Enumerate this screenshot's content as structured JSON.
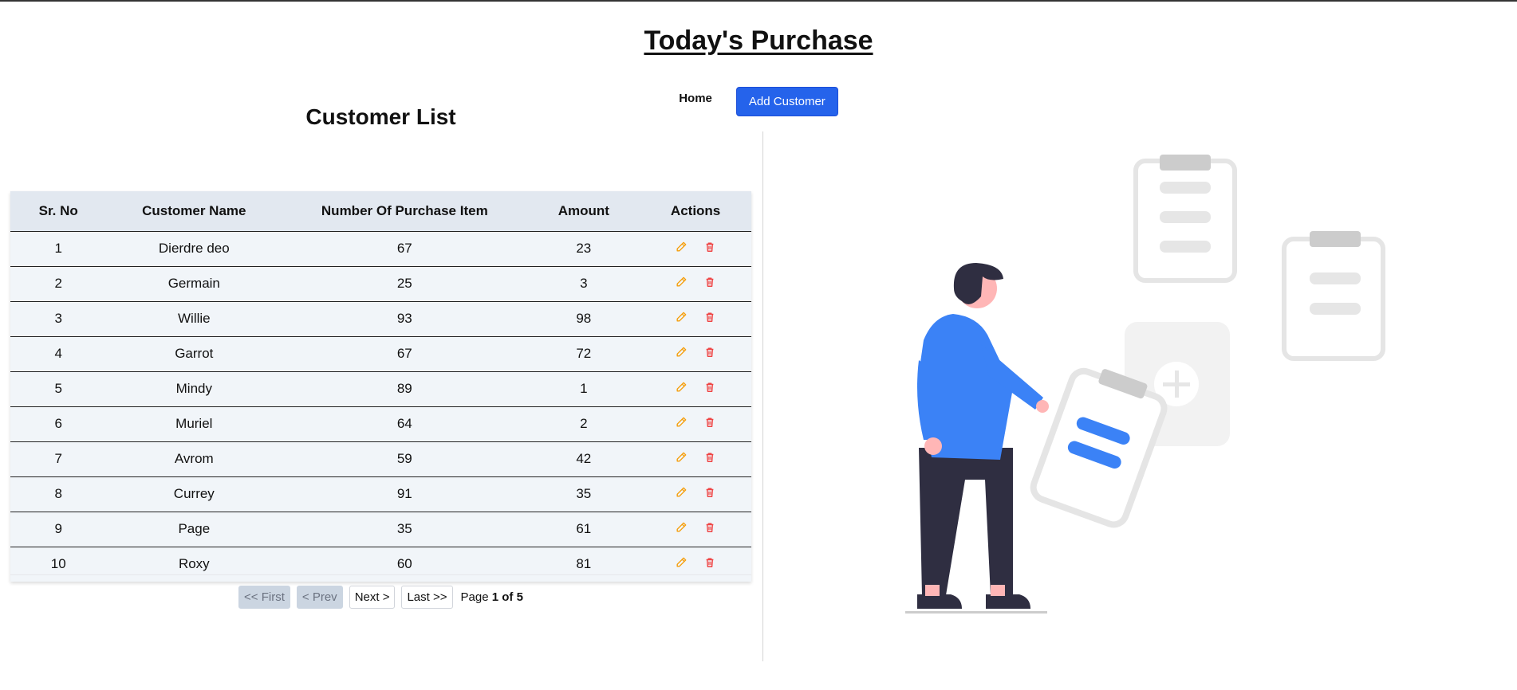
{
  "header": {
    "title": "Today's Purchase"
  },
  "nav": {
    "home_label": "Home",
    "add_customer_label": "Add Customer"
  },
  "customer_list": {
    "title": "Customer List",
    "columns": [
      "Sr. No",
      "Customer Name",
      "Number Of Purchase Item",
      "Amount",
      "Actions"
    ],
    "rows": [
      {
        "sr": "1",
        "name": "Dierdre deo",
        "items": "67",
        "amount": "23"
      },
      {
        "sr": "2",
        "name": "Germain",
        "items": "25",
        "amount": "3"
      },
      {
        "sr": "3",
        "name": "Willie",
        "items": "93",
        "amount": "98"
      },
      {
        "sr": "4",
        "name": "Garrot",
        "items": "67",
        "amount": "72"
      },
      {
        "sr": "5",
        "name": "Mindy",
        "items": "89",
        "amount": "1"
      },
      {
        "sr": "6",
        "name": "Muriel",
        "items": "64",
        "amount": "2"
      },
      {
        "sr": "7",
        "name": "Avrom",
        "items": "59",
        "amount": "42"
      },
      {
        "sr": "8",
        "name": "Currey",
        "items": "91",
        "amount": "35"
      },
      {
        "sr": "9",
        "name": "Page",
        "items": "35",
        "amount": "61"
      },
      {
        "sr": "10",
        "name": "Roxy",
        "items": "60",
        "amount": "81"
      }
    ],
    "action_icons": [
      "pencil-icon",
      "trash-icon"
    ]
  },
  "pagination": {
    "first_label": "<< First",
    "prev_label": "< Prev",
    "next_label": "Next >",
    "last_label": "Last >>",
    "page_prefix": "Page",
    "current": "1",
    "of_label": "of",
    "total": "5"
  },
  "colors": {
    "primary": "#2563eb",
    "edit_icon": "#f59e0b",
    "delete_icon": "#ef4444",
    "table_header": "#e2e8f0",
    "table_row": "#f1f5f9"
  }
}
